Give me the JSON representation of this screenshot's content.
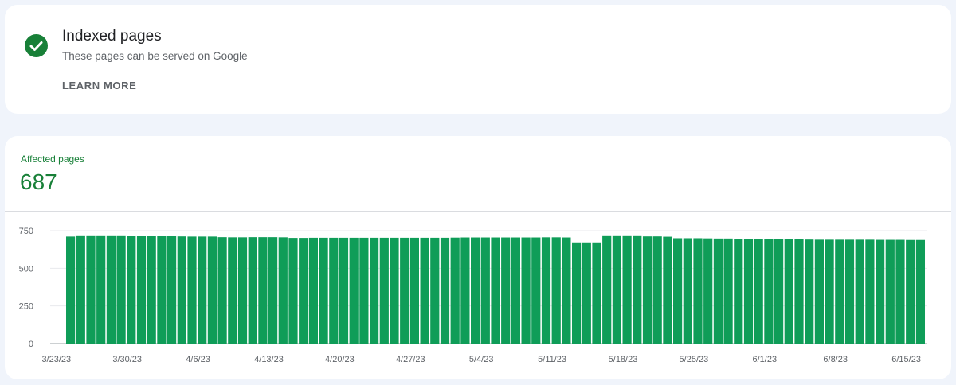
{
  "indexed_card": {
    "title": "Indexed pages",
    "subtitle": "These pages can be served on Google",
    "learn_more": "LEARN MORE",
    "status_icon": "check-circle-icon",
    "accent": "#188038"
  },
  "affected": {
    "label": "Affected pages",
    "value": "687"
  },
  "chart_data": {
    "type": "bar",
    "bar_color": "#0f9d58",
    "ylim": [
      0,
      750
    ],
    "y_ticks": [
      "0",
      "250",
      "500",
      "750"
    ],
    "grid": true,
    "x_start": "3/23/23",
    "x_tick_labels": [
      "3/23/23",
      "3/30/23",
      "4/6/23",
      "4/13/23",
      "4/20/23",
      "4/27/23",
      "5/4/23",
      "5/11/23",
      "5/18/23",
      "5/25/23",
      "6/1/23",
      "6/8/23",
      "6/15/23"
    ],
    "dates": [
      "3/24/23",
      "3/25/23",
      "3/26/23",
      "3/27/23",
      "3/28/23",
      "3/29/23",
      "3/30/23",
      "3/31/23",
      "4/1/23",
      "4/2/23",
      "4/3/23",
      "4/4/23",
      "4/5/23",
      "4/6/23",
      "4/7/23",
      "4/8/23",
      "4/9/23",
      "4/10/23",
      "4/11/23",
      "4/12/23",
      "4/13/23",
      "4/14/23",
      "4/15/23",
      "4/16/23",
      "4/17/23",
      "4/18/23",
      "4/19/23",
      "4/20/23",
      "4/21/23",
      "4/22/23",
      "4/23/23",
      "4/24/23",
      "4/25/23",
      "4/26/23",
      "4/27/23",
      "4/28/23",
      "4/29/23",
      "4/30/23",
      "5/1/23",
      "5/2/23",
      "5/3/23",
      "5/4/23",
      "5/5/23",
      "5/6/23",
      "5/7/23",
      "5/8/23",
      "5/9/23",
      "5/10/23",
      "5/11/23",
      "5/12/23",
      "5/13/23",
      "5/14/23",
      "5/15/23",
      "5/16/23",
      "5/17/23",
      "5/18/23",
      "5/19/23",
      "5/20/23",
      "5/21/23",
      "5/22/23",
      "5/23/23",
      "5/24/23",
      "5/25/23",
      "5/26/23",
      "5/27/23",
      "5/28/23",
      "5/29/23",
      "5/30/23",
      "5/31/23",
      "6/1/23",
      "6/2/23",
      "6/3/23",
      "6/4/23",
      "6/5/23",
      "6/6/23",
      "6/7/23",
      "6/8/23",
      "6/9/23",
      "6/10/23",
      "6/11/23",
      "6/12/23",
      "6/13/23",
      "6/14/23",
      "6/15/23",
      "6/16/23"
    ],
    "values": [
      711,
      714,
      714,
      714,
      714,
      714,
      713,
      713,
      713,
      713,
      713,
      712,
      711,
      711,
      711,
      707,
      706,
      706,
      707,
      707,
      707,
      706,
      702,
      702,
      703,
      703,
      703,
      703,
      703,
      703,
      703,
      703,
      703,
      703,
      703,
      703,
      703,
      703,
      704,
      705,
      705,
      705,
      705,
      705,
      705,
      705,
      705,
      706,
      706,
      705,
      672,
      672,
      672,
      714,
      714,
      714,
      714,
      712,
      712,
      710,
      700,
      700,
      700,
      699,
      698,
      698,
      697,
      697,
      695,
      695,
      694,
      692,
      692,
      691,
      690,
      690,
      690,
      690,
      690,
      690,
      689,
      689,
      689,
      688,
      688
    ]
  }
}
